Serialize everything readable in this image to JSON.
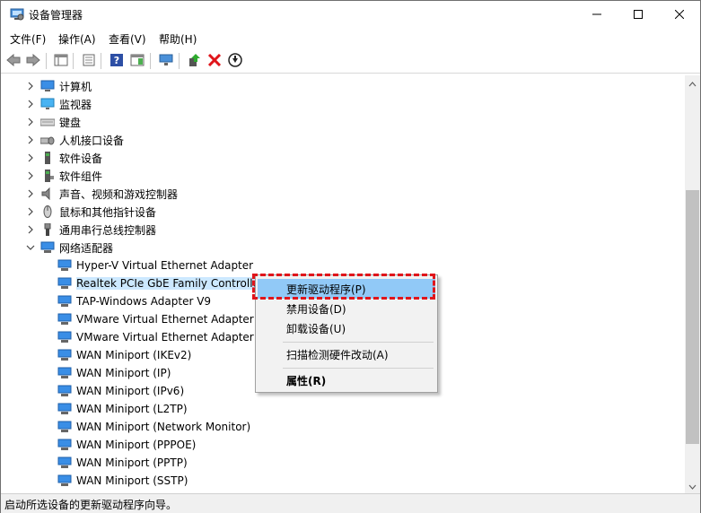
{
  "window": {
    "title": "设备管理器",
    "icon": "device-manager-icon",
    "controls": [
      "minimize-icon",
      "maximize-icon",
      "close-icon"
    ]
  },
  "menubar": {
    "items": [
      {
        "label": "文件(F)"
      },
      {
        "label": "操作(A)"
      },
      {
        "label": "查看(V)"
      },
      {
        "label": "帮助(H)"
      }
    ]
  },
  "toolbar": {
    "buttons": [
      "back-icon",
      "forward-icon",
      "show-hide-tree-icon",
      "properties-icon",
      "help-icon",
      "action-pane-icon",
      "scan-hardware-icon",
      "update-driver-icon",
      "uninstall-device-icon",
      "enable-device-icon"
    ]
  },
  "tree": {
    "categories": [
      {
        "label": "计算机",
        "icon": "computer-icon",
        "expanded": false
      },
      {
        "label": "监视器",
        "icon": "monitor-icon",
        "expanded": false
      },
      {
        "label": "键盘",
        "icon": "keyboard-icon",
        "expanded": false
      },
      {
        "label": "人机接口设备",
        "icon": "hid-icon",
        "expanded": false
      },
      {
        "label": "软件设备",
        "icon": "software-device-icon",
        "expanded": false
      },
      {
        "label": "软件组件",
        "icon": "software-component-icon",
        "expanded": false
      },
      {
        "label": "声音、视频和游戏控制器",
        "icon": "audio-icon",
        "expanded": false
      },
      {
        "label": "鼠标和其他指针设备",
        "icon": "mouse-icon",
        "expanded": false
      },
      {
        "label": "通用串行总线控制器",
        "icon": "usb-icon",
        "expanded": false
      },
      {
        "label": "网络适配器",
        "icon": "network-adapter-icon",
        "expanded": true
      }
    ],
    "network_adapters": [
      {
        "label": "Hyper-V Virtual Ethernet Adapter"
      },
      {
        "label": "Realtek PCIe GbE Family Controlle",
        "selected": true
      },
      {
        "label": "TAP-Windows Adapter V9"
      },
      {
        "label": "VMware Virtual Ethernet Adapter f"
      },
      {
        "label": "VMware Virtual Ethernet Adapter f"
      },
      {
        "label": "WAN Miniport (IKEv2)"
      },
      {
        "label": "WAN Miniport (IP)"
      },
      {
        "label": "WAN Miniport (IPv6)"
      },
      {
        "label": "WAN Miniport (L2TP)"
      },
      {
        "label": "WAN Miniport (Network Monitor)"
      },
      {
        "label": "WAN Miniport (PPPOE)"
      },
      {
        "label": "WAN Miniport (PPTP)"
      },
      {
        "label": "WAN Miniport (SSTP)"
      }
    ]
  },
  "context_menu": {
    "items": [
      {
        "label": "更新驱动程序(P)",
        "highlighted": true
      },
      {
        "label": "禁用设备(D)"
      },
      {
        "label": "卸载设备(U)"
      },
      {
        "label": "扫描检测硬件改动(A)"
      },
      {
        "label": "属性(R)",
        "bold": true
      }
    ]
  },
  "status": {
    "text": "启动所选设备的更新驱动程序向导。"
  },
  "colors": {
    "selection": "#cce8ff",
    "menu_highlight": "#91c9f7",
    "annotation_red": "#e0151b"
  }
}
